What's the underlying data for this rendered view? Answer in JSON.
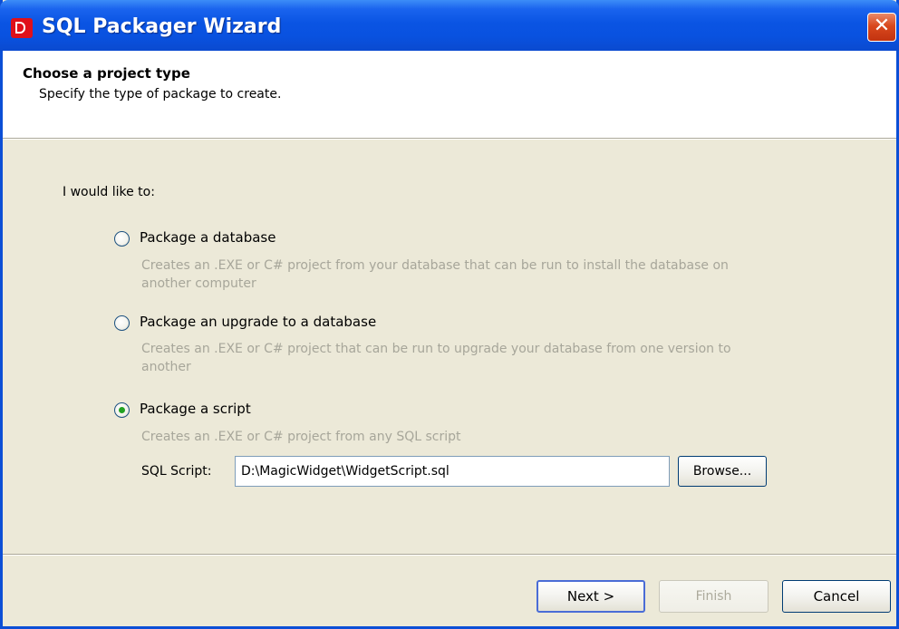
{
  "window": {
    "title": "SQL Packager Wizard",
    "close_glyph": "✕",
    "colors": {
      "titlebar": "#0a54e3",
      "dialog_background": "#ece9d8",
      "header_background": "#ffffff",
      "disabled_text": "#a7a69a"
    }
  },
  "header": {
    "title": "Choose a project type",
    "subtitle": "Specify the type of package to create."
  },
  "intro": "I would like to:",
  "options": [
    {
      "label": "Package a database",
      "description": "Creates an .EXE or C# project from your database that can be run to install the database on another computer",
      "checked": false
    },
    {
      "label": "Package an upgrade to a database",
      "description": "Creates an .EXE or C# project that can be run to upgrade your database from one version to another",
      "checked": false
    },
    {
      "label": "Package a script",
      "description": "Creates an .EXE or C# project from any SQL script",
      "checked": true
    }
  ],
  "script": {
    "label": "SQL Script:",
    "value": "D:\\MagicWidget\\WidgetScript.sql",
    "browse_label": "Browse..."
  },
  "buttons": {
    "next": "Next >",
    "finish": "Finish",
    "cancel": "Cancel"
  },
  "icons": {
    "app": "sql-packager-app-icon",
    "close": "close-icon",
    "radio": "radio-icon"
  }
}
